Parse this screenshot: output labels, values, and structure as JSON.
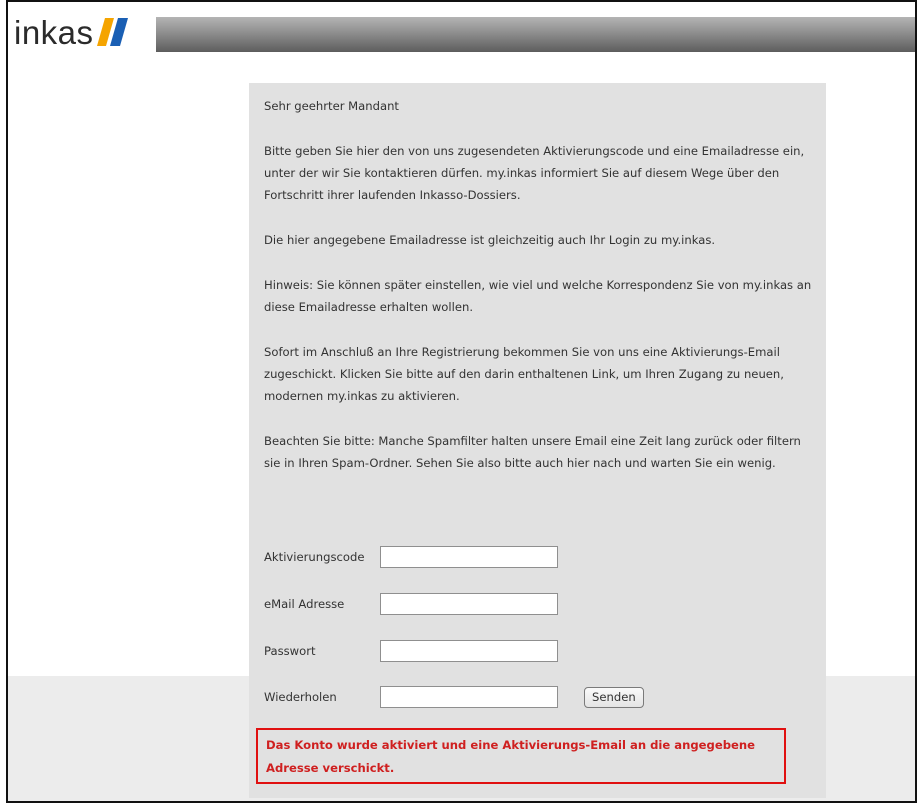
{
  "header": {
    "logo_text": "inkas",
    "logo_colors": {
      "slash1": "#f5a400",
      "slash2": "#1a5fb4"
    }
  },
  "intro": {
    "salutation": "Sehr geehrter Mandant",
    "paragraph1": "Bitte geben Sie hier den von uns zugesendeten Aktivierungscode und eine Emailadresse ein, unter der wir Sie kontaktieren dürfen. my.inkas informiert Sie auf diesem Wege über den Fortschritt ihrer laufenden Inkasso-Dossiers.",
    "paragraph2": "Die hier angegebene Emailadresse ist gleichzeitig auch Ihr Login zu my.inkas.",
    "paragraph3": "Hinweis: Sie können später einstellen, wie viel und welche Korrespondenz Sie von my.inkas an diese Emailadresse erhalten wollen.",
    "paragraph4": "Sofort im Anschluß an Ihre Registrierung bekommen Sie von uns eine Aktivierungs-Email zugeschickt. Klicken Sie bitte auf den darin enthaltenen Link, um Ihren Zugang zu neuen, modernen my.inkas zu aktivieren.",
    "paragraph5": "Beachten Sie bitte: Manche Spamfilter halten unsere Email eine Zeit lang zurück oder filtern sie in Ihren Spam-Ordner. Sehen Sie also bitte auch hier nach und warten Sie ein wenig."
  },
  "form": {
    "activation_code": {
      "label": "Aktivierungscode",
      "value": ""
    },
    "email": {
      "label": "eMail Adresse",
      "value": ""
    },
    "password": {
      "label": "Passwort",
      "value": ""
    },
    "repeat": {
      "label": "Wiederholen",
      "value": ""
    },
    "send_label": "Senden"
  },
  "status": {
    "message": "Das Konto wurde aktiviert und eine Aktivierungs-Email an die angegebene Adresse verschickt.",
    "color": "#cf2020"
  }
}
